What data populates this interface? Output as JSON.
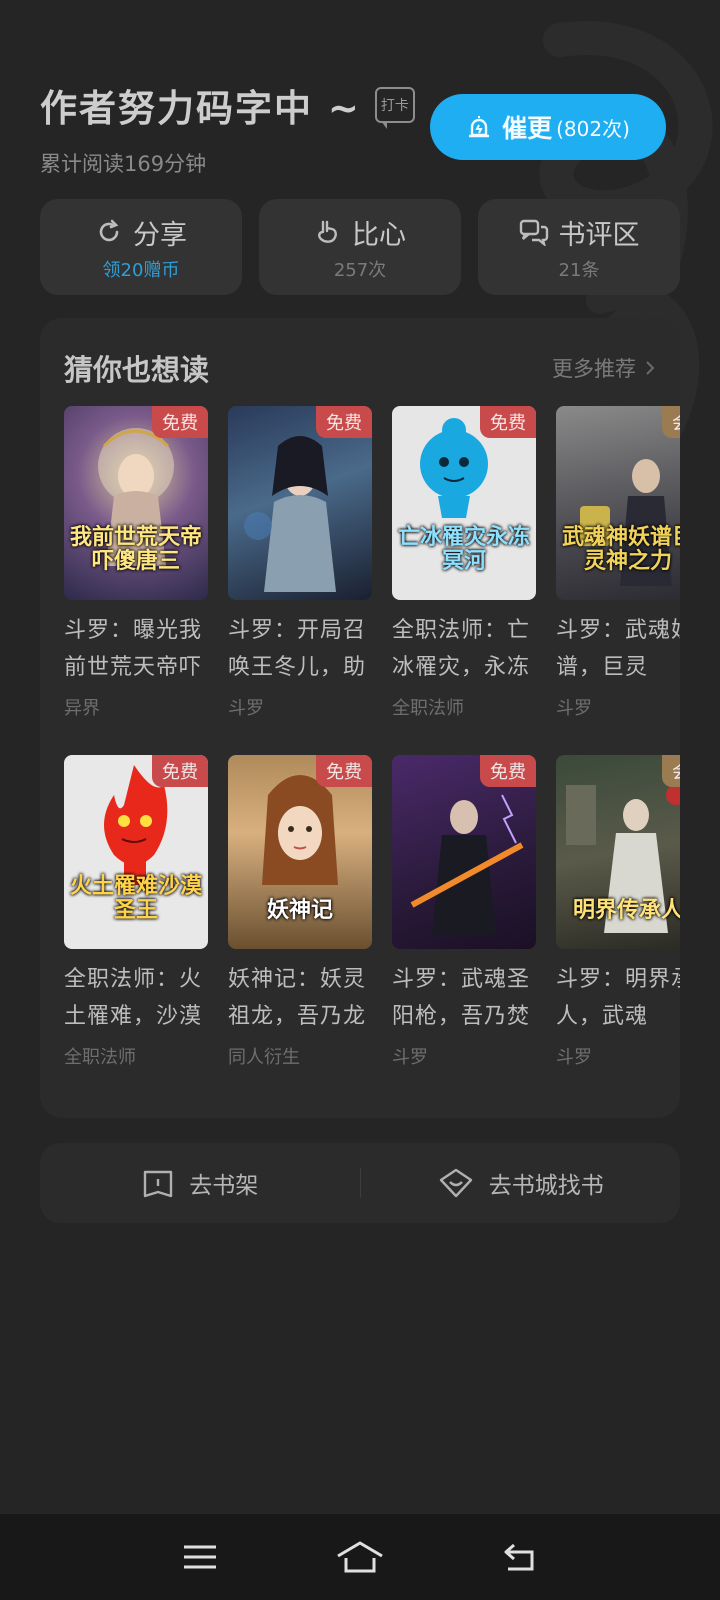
{
  "header": {
    "title": "作者努力码字中 ~",
    "checkin_label": "打卡",
    "read_time": "累计阅读169分钟",
    "urge_button": {
      "label": "催更",
      "count": "(802次)"
    }
  },
  "actions": [
    {
      "icon": "share-icon",
      "label": "分享",
      "sub": "领20赠币"
    },
    {
      "icon": "heart-hand-icon",
      "label": "比心",
      "sub": "257次"
    },
    {
      "icon": "comment-icon",
      "label": "书评区",
      "sub": "21条"
    }
  ],
  "recommend": {
    "title": "猜你也想读",
    "more": "更多推荐",
    "books": [
      {
        "title": "斗罗：曝光我前世荒天帝吓",
        "category": "异界",
        "badge": "免费",
        "cover_text": "我前世荒天帝吓傻唐三"
      },
      {
        "title": "斗罗：开局召唤王冬儿，助",
        "category": "斗罗",
        "badge": "免费",
        "cover_text": ""
      },
      {
        "title": "全职法师：亡冰罹灾，永冻",
        "category": "全职法师",
        "badge": "免费",
        "cover_text": "亡冰罹灾永冻冥河"
      },
      {
        "title": "斗罗：武魂妖谱，巨灵",
        "category": "斗罗",
        "badge": "会",
        "cover_text": "武魂神妖谱巨灵神之力"
      },
      {
        "title": "全职法师：火土罹难，沙漠",
        "category": "全职法师",
        "badge": "免费",
        "cover_text": "火土罹难沙漠圣王"
      },
      {
        "title": "妖神记：妖灵祖龙，吾乃龙",
        "category": "同人衍生",
        "badge": "免费",
        "cover_text": "妖神记"
      },
      {
        "title": "斗罗：武魂圣阳枪，吾乃焚",
        "category": "斗罗",
        "badge": "免费",
        "cover_text": ""
      },
      {
        "title": "斗罗：明界承人，武魂",
        "category": "斗罗",
        "badge": "会",
        "cover_text": "明界传承人"
      }
    ]
  },
  "bottom": {
    "bookshelf": "去书架",
    "bookstore": "去书城找书"
  },
  "colors": {
    "accent": "#1eaef1",
    "background": "#252525",
    "card": "#333333",
    "badge_free": "#c94a4a"
  }
}
